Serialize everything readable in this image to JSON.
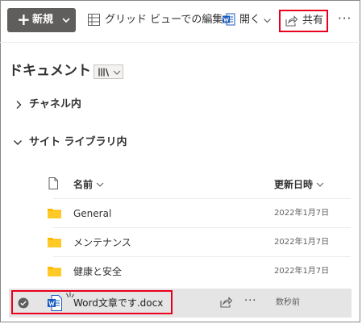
{
  "toolbar": {
    "new_label": "新規",
    "grid_label": "グリッド ビューでの編集",
    "open_label": "開く",
    "share_label": "共有",
    "more_label": "···"
  },
  "page": {
    "title": "ドキュメント"
  },
  "groups": {
    "channel": "チャネル内",
    "site": "サイト ライブラリ内"
  },
  "columns": {
    "name": "名前",
    "modified": "更新日時"
  },
  "rows": [
    {
      "name": "General",
      "modified": "2022年1月7日",
      "kind": "folder"
    },
    {
      "name": "メンテナンス",
      "modified": "2022年1月7日",
      "kind": "folder"
    },
    {
      "name": "健康と安全",
      "modified": "2022年1月7日",
      "kind": "folder"
    }
  ],
  "selected_file": {
    "name": "Word文章です.docx",
    "modified": "数秒前",
    "more_label": "···"
  },
  "colors": {
    "highlight": "#e8001c",
    "new_button": "#605e5c",
    "folder": "#ffb900",
    "word": "#185abd",
    "selected_row": "#e5e5e5"
  }
}
